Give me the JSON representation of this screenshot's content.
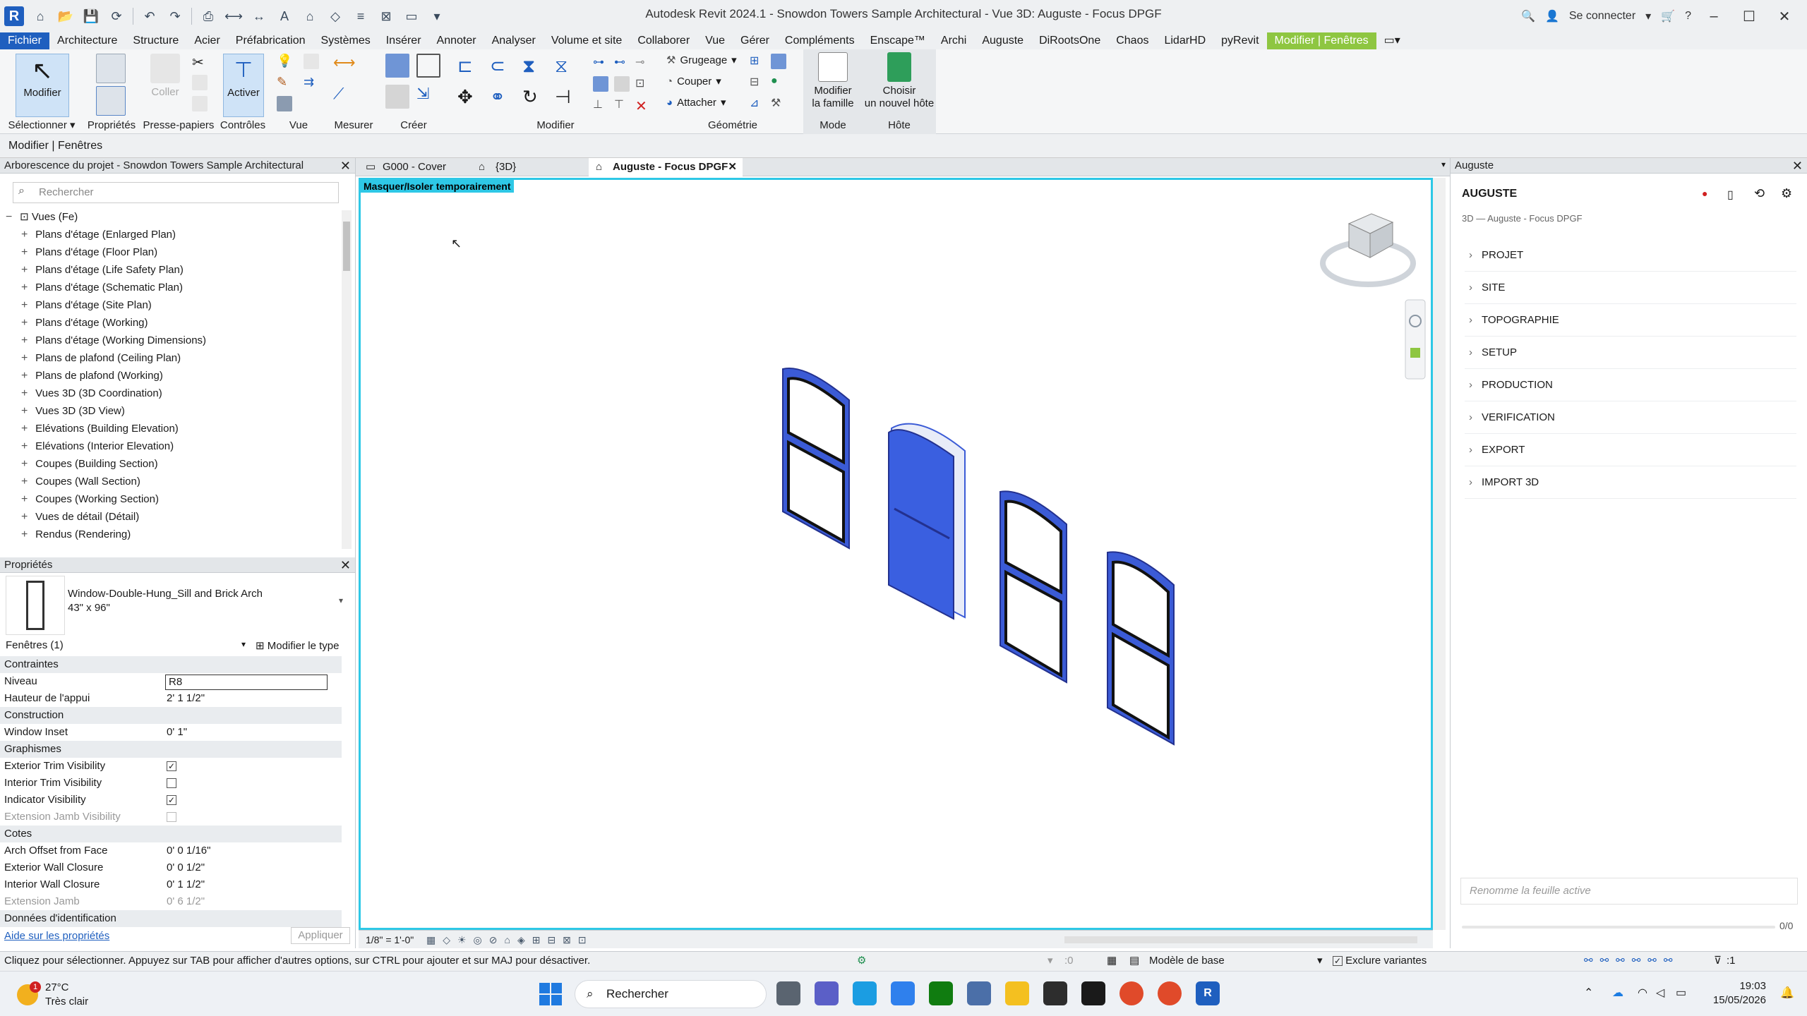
{
  "app": {
    "logo": "R",
    "title": "Autodesk Revit 2024.1 - Snowdon Towers Sample Architectural - Vue 3D: Auguste - Focus DPGF",
    "sign_in": "Se connecter"
  },
  "menu": {
    "tabs": [
      "Fichier",
      "Architecture",
      "Structure",
      "Acier",
      "Préfabrication",
      "Systèmes",
      "Insérer",
      "Annoter",
      "Analyser",
      "Volume et site",
      "Collaborer",
      "Vue",
      "Gérer",
      "Compléments",
      "Enscape™",
      "Archi",
      "Auguste",
      "DiRootsOne",
      "Chaos",
      "LidarHD",
      "pyRevit",
      "Modifier | Fenêtres"
    ]
  },
  "ribbon": {
    "modifier": "Modifier",
    "activer": "Activer",
    "coller": "Coller",
    "grugeage": "Grugeage",
    "couper": "Couper",
    "attacher": "Attacher",
    "modifier_famille": [
      "Modifier",
      "la famille"
    ],
    "choisir_hote": [
      "Choisir",
      "un nouvel hôte"
    ],
    "panels": {
      "selectionner": "Sélectionner",
      "proprietes": "Propriétés",
      "presse_papiers": "Presse-papiers",
      "controles": "Contrôles",
      "vue": "Vue",
      "mesurer": "Mesurer",
      "creer": "Créer",
      "modifier": "Modifier",
      "geometrie": "Géométrie",
      "mode": "Mode",
      "hote": "Hôte"
    }
  },
  "options_bar": "Modifier | Fenêtres",
  "browser": {
    "title": "Arborescence du projet - Snowdon Towers Sample Architectural",
    "search_placeholder": "Rechercher",
    "root": "Vues (Fe)",
    "items": [
      "Plans d'étage (Enlarged Plan)",
      "Plans d'étage (Floor Plan)",
      "Plans d'étage (Life Safety Plan)",
      "Plans d'étage (Schematic Plan)",
      "Plans d'étage (Site Plan)",
      "Plans d'étage (Working)",
      "Plans d'étage (Working Dimensions)",
      "Plans de plafond (Ceiling Plan)",
      "Plans de plafond (Working)",
      "Vues 3D (3D Coordination)",
      "Vues 3D (3D View)",
      "Elévations (Building Elevation)",
      "Elévations (Interior Elevation)",
      "Coupes (Building Section)",
      "Coupes (Wall Section)",
      "Coupes (Working Section)",
      "Vues de détail (Détail)",
      "Rendus (Rendering)"
    ]
  },
  "properties": {
    "title": "Propriétés",
    "family": "Window-Double-Hung_Sill and Brick Arch",
    "type": "43\" x 96\"",
    "filter": "Fenêtres (1)",
    "edit_type": "Modifier le type",
    "sections": {
      "contraintes": "Contraintes",
      "construction": "Construction",
      "graphismes": "Graphismes",
      "cotes": "Cotes",
      "donnees": "Données d'identification"
    },
    "rows": {
      "niveau": [
        "Niveau",
        "R8"
      ],
      "hauteur": [
        "Hauteur de l'appui",
        "2'  1 1/2\""
      ],
      "inset": [
        "Window Inset",
        "0'  1\""
      ],
      "ext_trim": "Exterior Trim Visibility",
      "int_trim": "Interior Trim Visibility",
      "indicator": "Indicator Visibility",
      "ext_jamb": "Extension Jamb Visibility",
      "arch_offset": [
        "Arch Offset from Face",
        "0'  0 1/16\""
      ],
      "ext_wall": [
        "Exterior Wall Closure",
        "0'  0 1/2\""
      ],
      "int_wall": [
        "Interior Wall Closure",
        "0'  1 1/2\""
      ],
      "ext_jamb_val": [
        "Extension Jamb",
        "0'  6 1/2\""
      ]
    },
    "help": "Aide sur les propriétés",
    "apply": "Appliquer"
  },
  "view_tabs": [
    "G000 - Cover",
    "{3D}",
    "Auguste - Focus DPGF"
  ],
  "view": {
    "isolate_label": "Masquer/Isoler temporairement",
    "scale": "1/8\" = 1'-0\""
  },
  "auguste": {
    "dock_title": "Auguste",
    "title": "AUGUSTE",
    "subtitle": "3D — Auguste - Focus DPGF",
    "sections": [
      "PROJET",
      "SITE",
      "TOPOGRAPHIE",
      "SETUP",
      "PRODUCTION",
      "VERIFICATION",
      "EXPORT",
      "IMPORT 3D"
    ],
    "rename_placeholder": "Renomme la feuille active",
    "counter": "0/0"
  },
  "status": {
    "hint": "Cliquez pour sélectionner. Appuyez sur TAB pour afficher d'autres options, sur CTRL pour ajouter et sur MAJ pour désactiver.",
    "zero": ":0",
    "model": "Modèle de base",
    "exclude": "Exclure variantes",
    "filter_count": ":1"
  },
  "taskbar": {
    "temp": "27°C",
    "weather": "Très clair",
    "search": "Rechercher",
    "time": "19:03",
    "date": "15/05/2026",
    "badge": "1"
  },
  "colors": {
    "accent": "#1f5fbf",
    "context_tab": "#8ec641",
    "view_border": "#2ec8e6",
    "window_frame": "#3b5bd6",
    "selected_fill": "#3a5fe0"
  }
}
